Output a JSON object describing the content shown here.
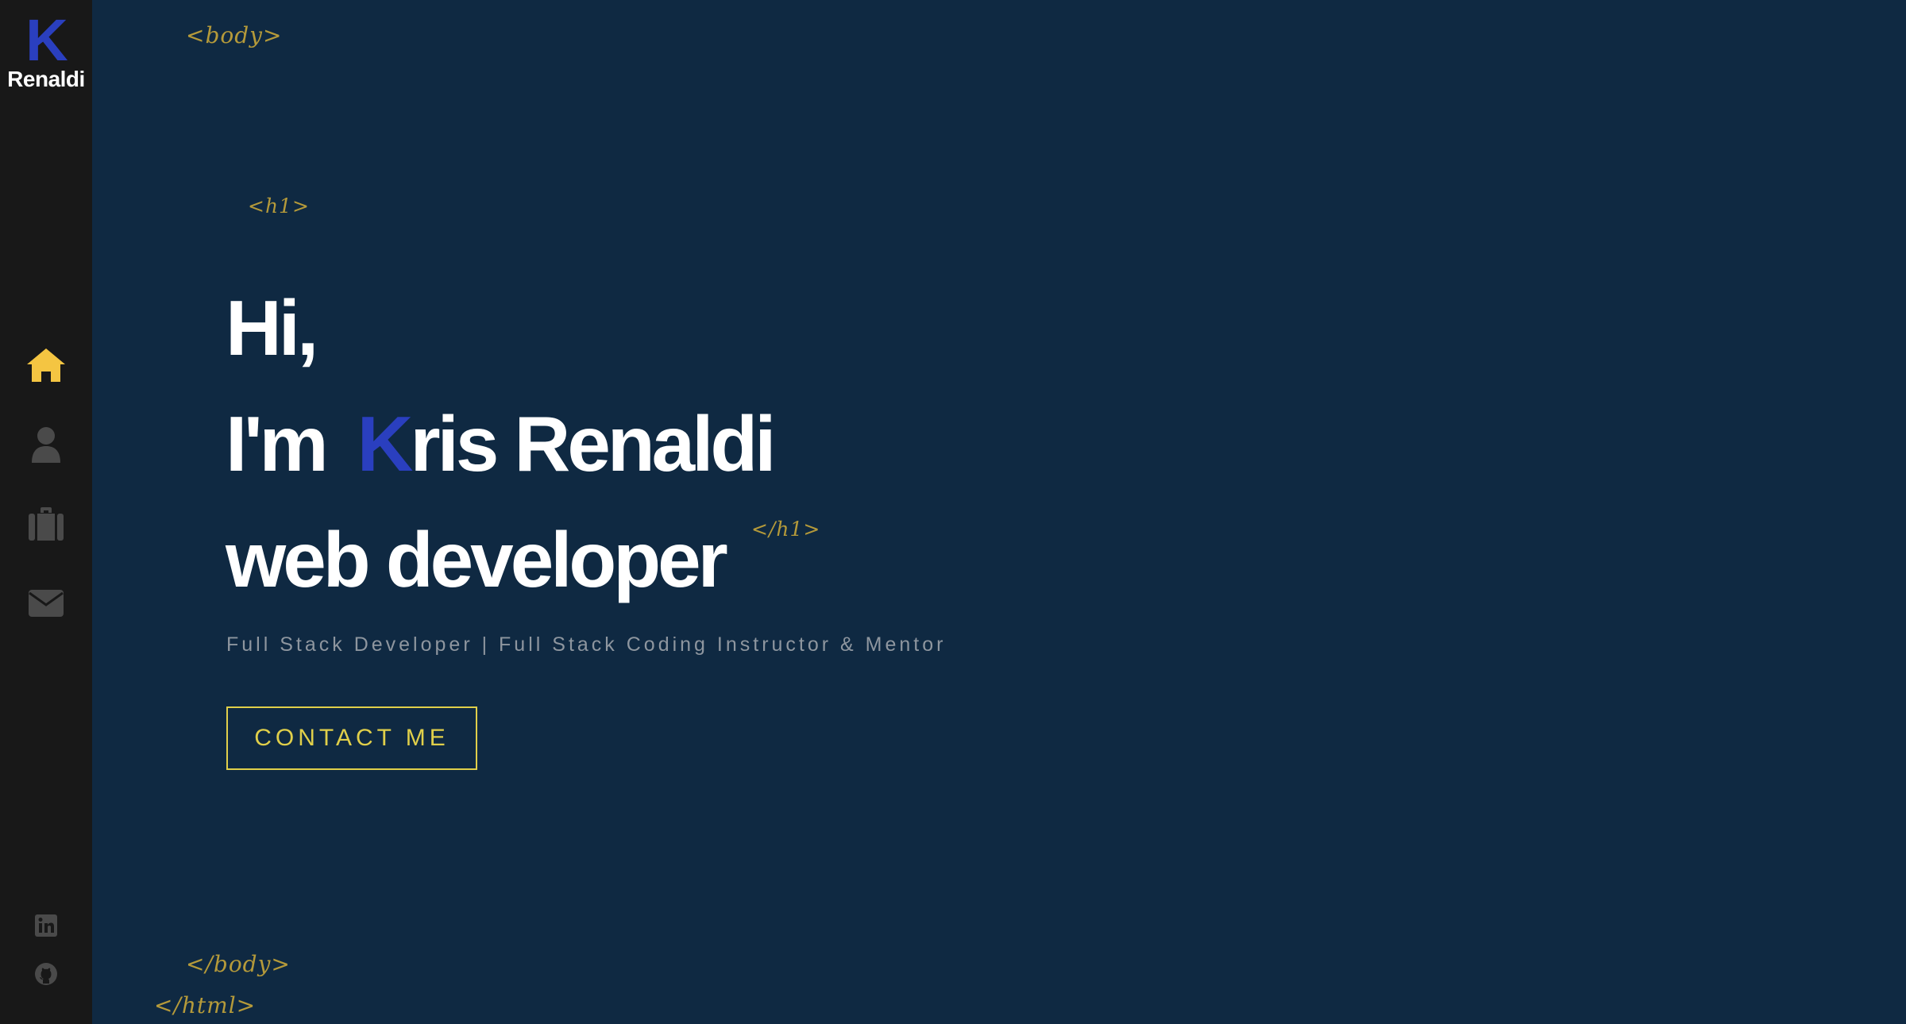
{
  "sidebar": {
    "logo_letter": "K",
    "logo_name": "Renaldi",
    "nav": [
      {
        "icon": "home-icon",
        "active": true,
        "color": "#f4c542"
      },
      {
        "icon": "user-icon",
        "active": false,
        "color": "#4a4a4a"
      },
      {
        "icon": "briefcase-icon",
        "active": false,
        "color": "#4a4a4a"
      },
      {
        "icon": "envelope-icon",
        "active": false,
        "color": "#4a4a4a"
      }
    ],
    "social": [
      {
        "icon": "linkedin-icon"
      },
      {
        "icon": "github-icon"
      }
    ]
  },
  "tags": {
    "body_open": "<body>",
    "h1_open": "<h1>",
    "h1_close": "</h1>",
    "body_close": "</body>",
    "html_close": "</html>"
  },
  "hero": {
    "line1": "Hi,",
    "line2_prefix": "I'm",
    "line2_accent": "K",
    "line2_rest": "ris Renaldi",
    "line3": "web developer",
    "subtitle": "Full Stack Developer | Full Stack Coding Instructor & Mentor",
    "cta_label": "CONTACT ME"
  },
  "colors": {
    "background": "#0f2942",
    "sidebar": "#181818",
    "accent_blue": "#2a3fbf",
    "accent_yellow": "#e0cf4a",
    "tag_gold": "#b59a3a"
  }
}
